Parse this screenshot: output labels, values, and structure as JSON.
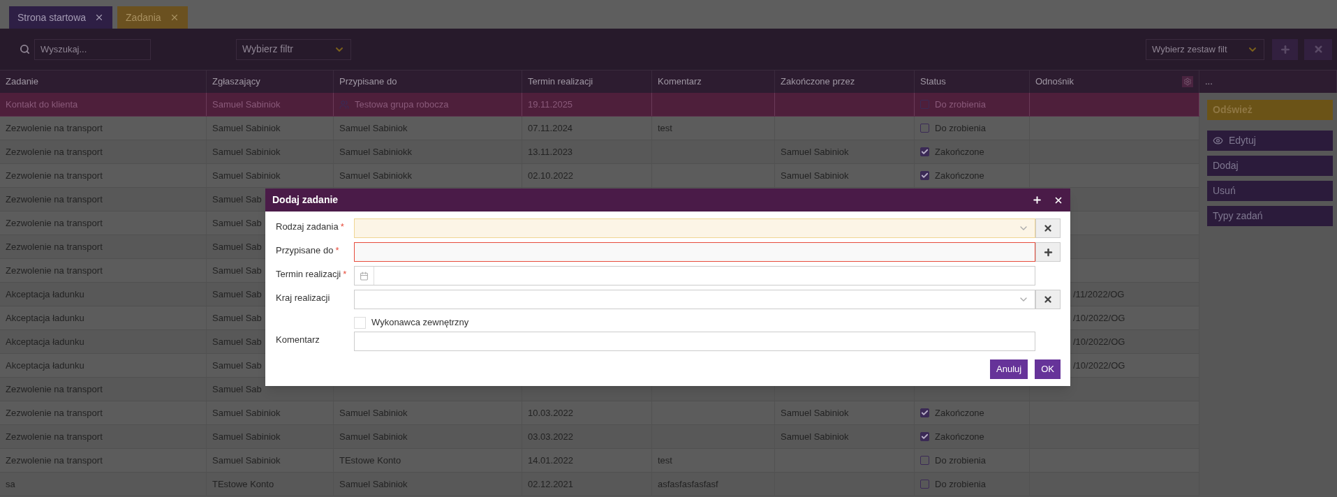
{
  "tabs": [
    {
      "label": "Strona startowa",
      "selected": false
    },
    {
      "label": "Zadania",
      "selected": true
    }
  ],
  "toolbar": {
    "search": {
      "placeholder": "Wyszukaj..."
    },
    "filter": {
      "placeholder": "Wybierz filtr"
    },
    "filter_set": {
      "placeholder": "Wybierz zestaw filt"
    }
  },
  "table": {
    "columns": [
      "Zadanie",
      "Zgłaszający",
      "Przypisane do",
      "Termin realizacji",
      "Komentarz",
      "Zakończone przez",
      "Status",
      "Odnośnik",
      "..."
    ],
    "rows": [
      {
        "selected": true,
        "group": true,
        "cells": [
          "Kontakt do klienta",
          "Samuel Sabiniok",
          "Testowa grupa robocza",
          "19.11.2025",
          null,
          null,
          null
        ],
        "status": {
          "checked": false,
          "label": "Do zrobienia"
        }
      },
      {
        "selected": false,
        "cells": [
          "Zezwolenie na transport",
          "Samuel Sabiniok",
          "Samuel Sabiniok",
          "07.11.2024",
          "test",
          null,
          null
        ],
        "status": {
          "checked": false,
          "label": "Do zrobienia"
        }
      },
      {
        "selected": false,
        "cells": [
          "Zezwolenie na transport",
          "Samuel Sabiniok",
          "Samuel Sabiniokk",
          "13.11.2023",
          null,
          "Samuel Sabiniok",
          null
        ],
        "status": {
          "checked": true,
          "label": "Zakończone"
        }
      },
      {
        "selected": false,
        "cells": [
          "Zezwolenie na transport",
          "Samuel Sabiniok",
          "Samuel Sabiniokk",
          "02.10.2022",
          null,
          "Samuel Sabiniok",
          null
        ],
        "status": {
          "checked": true,
          "label": "Zakończone"
        }
      },
      {
        "selected": false,
        "cells": [
          "Zezwolenie na transport",
          "Samuel Sab",
          null,
          null,
          null,
          null,
          null
        ]
      },
      {
        "selected": false,
        "cells": [
          "Zezwolenie na transport",
          "Samuel Sab",
          null,
          null,
          null,
          null,
          null
        ]
      },
      {
        "selected": false,
        "cells": [
          "Zezwolenie na transport",
          "Samuel Sab",
          null,
          null,
          null,
          null,
          null
        ]
      },
      {
        "selected": false,
        "cells": [
          "Zezwolenie na transport",
          "Samuel Sab",
          null,
          null,
          null,
          null,
          null
        ]
      },
      {
        "selected": false,
        "cells": [
          "Akceptacja ładunku",
          "Samuel Sab",
          null,
          null,
          null,
          null,
          "/11/2022/OG"
        ]
      },
      {
        "selected": false,
        "cells": [
          "Akceptacja ładunku",
          "Samuel Sab",
          null,
          null,
          null,
          null,
          "/10/2022/OG"
        ]
      },
      {
        "selected": false,
        "cells": [
          "Akceptacja ładunku",
          "Samuel Sab",
          null,
          null,
          null,
          null,
          "/10/2022/OG"
        ]
      },
      {
        "selected": false,
        "cells": [
          "Akceptacja ładunku",
          "Samuel Sab",
          null,
          null,
          null,
          null,
          "/10/2022/OG"
        ]
      },
      {
        "selected": false,
        "cells": [
          "Zezwolenie na transport",
          "Samuel Sab",
          null,
          null,
          null,
          null,
          null
        ]
      },
      {
        "selected": false,
        "cells": [
          "Zezwolenie na transport",
          "Samuel Sabiniok",
          "Samuel Sabiniok",
          "10.03.2022",
          null,
          "Samuel Sabiniok",
          null
        ],
        "status": {
          "checked": true,
          "label": "Zakończone"
        }
      },
      {
        "selected": false,
        "cells": [
          "Zezwolenie na transport",
          "Samuel Sabiniok",
          "Samuel Sabiniok",
          "03.03.2022",
          null,
          "Samuel Sabiniok",
          null
        ],
        "status": {
          "checked": true,
          "label": "Zakończone"
        }
      },
      {
        "selected": false,
        "cells": [
          "Zezwolenie na transport",
          "Samuel Sabiniok",
          "TEstowe Konto",
          "14.01.2022",
          "test",
          null,
          null
        ],
        "status": {
          "checked": false,
          "label": "Do zrobienia"
        }
      },
      {
        "selected": false,
        "cells": [
          "sa",
          "TEstowe Konto",
          "Samuel Sabiniok",
          "02.12.2021",
          "asfasfasfasfasf",
          null,
          null
        ],
        "status": {
          "checked": false,
          "label": "Do zrobienia"
        }
      }
    ]
  },
  "side_buttons": [
    {
      "label": "Odśwież",
      "kind": "refresh"
    },
    {
      "label": "Edytuj",
      "kind": "view"
    },
    {
      "label": "Dodaj",
      "kind": "plain"
    },
    {
      "label": "Usuń",
      "kind": "plain"
    },
    {
      "label": "Typy zadań",
      "kind": "plain"
    }
  ],
  "dialog": {
    "title": "Dodaj zadanie",
    "fields": [
      {
        "kind": "select",
        "label": "Rodzaj zadania",
        "required_mark": "*",
        "highlighted": true,
        "invalid": false
      },
      {
        "kind": "lookup",
        "label": "Przypisane do",
        "required_mark": "*",
        "highlighted": false,
        "invalid": true
      },
      {
        "kind": "date",
        "label": "Termin realizacji",
        "required_mark": "*",
        "highlighted": false,
        "invalid": false
      },
      {
        "kind": "select",
        "label": "Kraj realizacji",
        "highlighted": false,
        "invalid": false
      },
      {
        "kind": "checkbox",
        "label": "Wykonawca zewnętrzny",
        "checked": false
      },
      {
        "kind": "text",
        "label": "Komentarz",
        "highlighted": false,
        "invalid": false
      }
    ],
    "buttons": [
      "Anuluj",
      "OK"
    ]
  }
}
